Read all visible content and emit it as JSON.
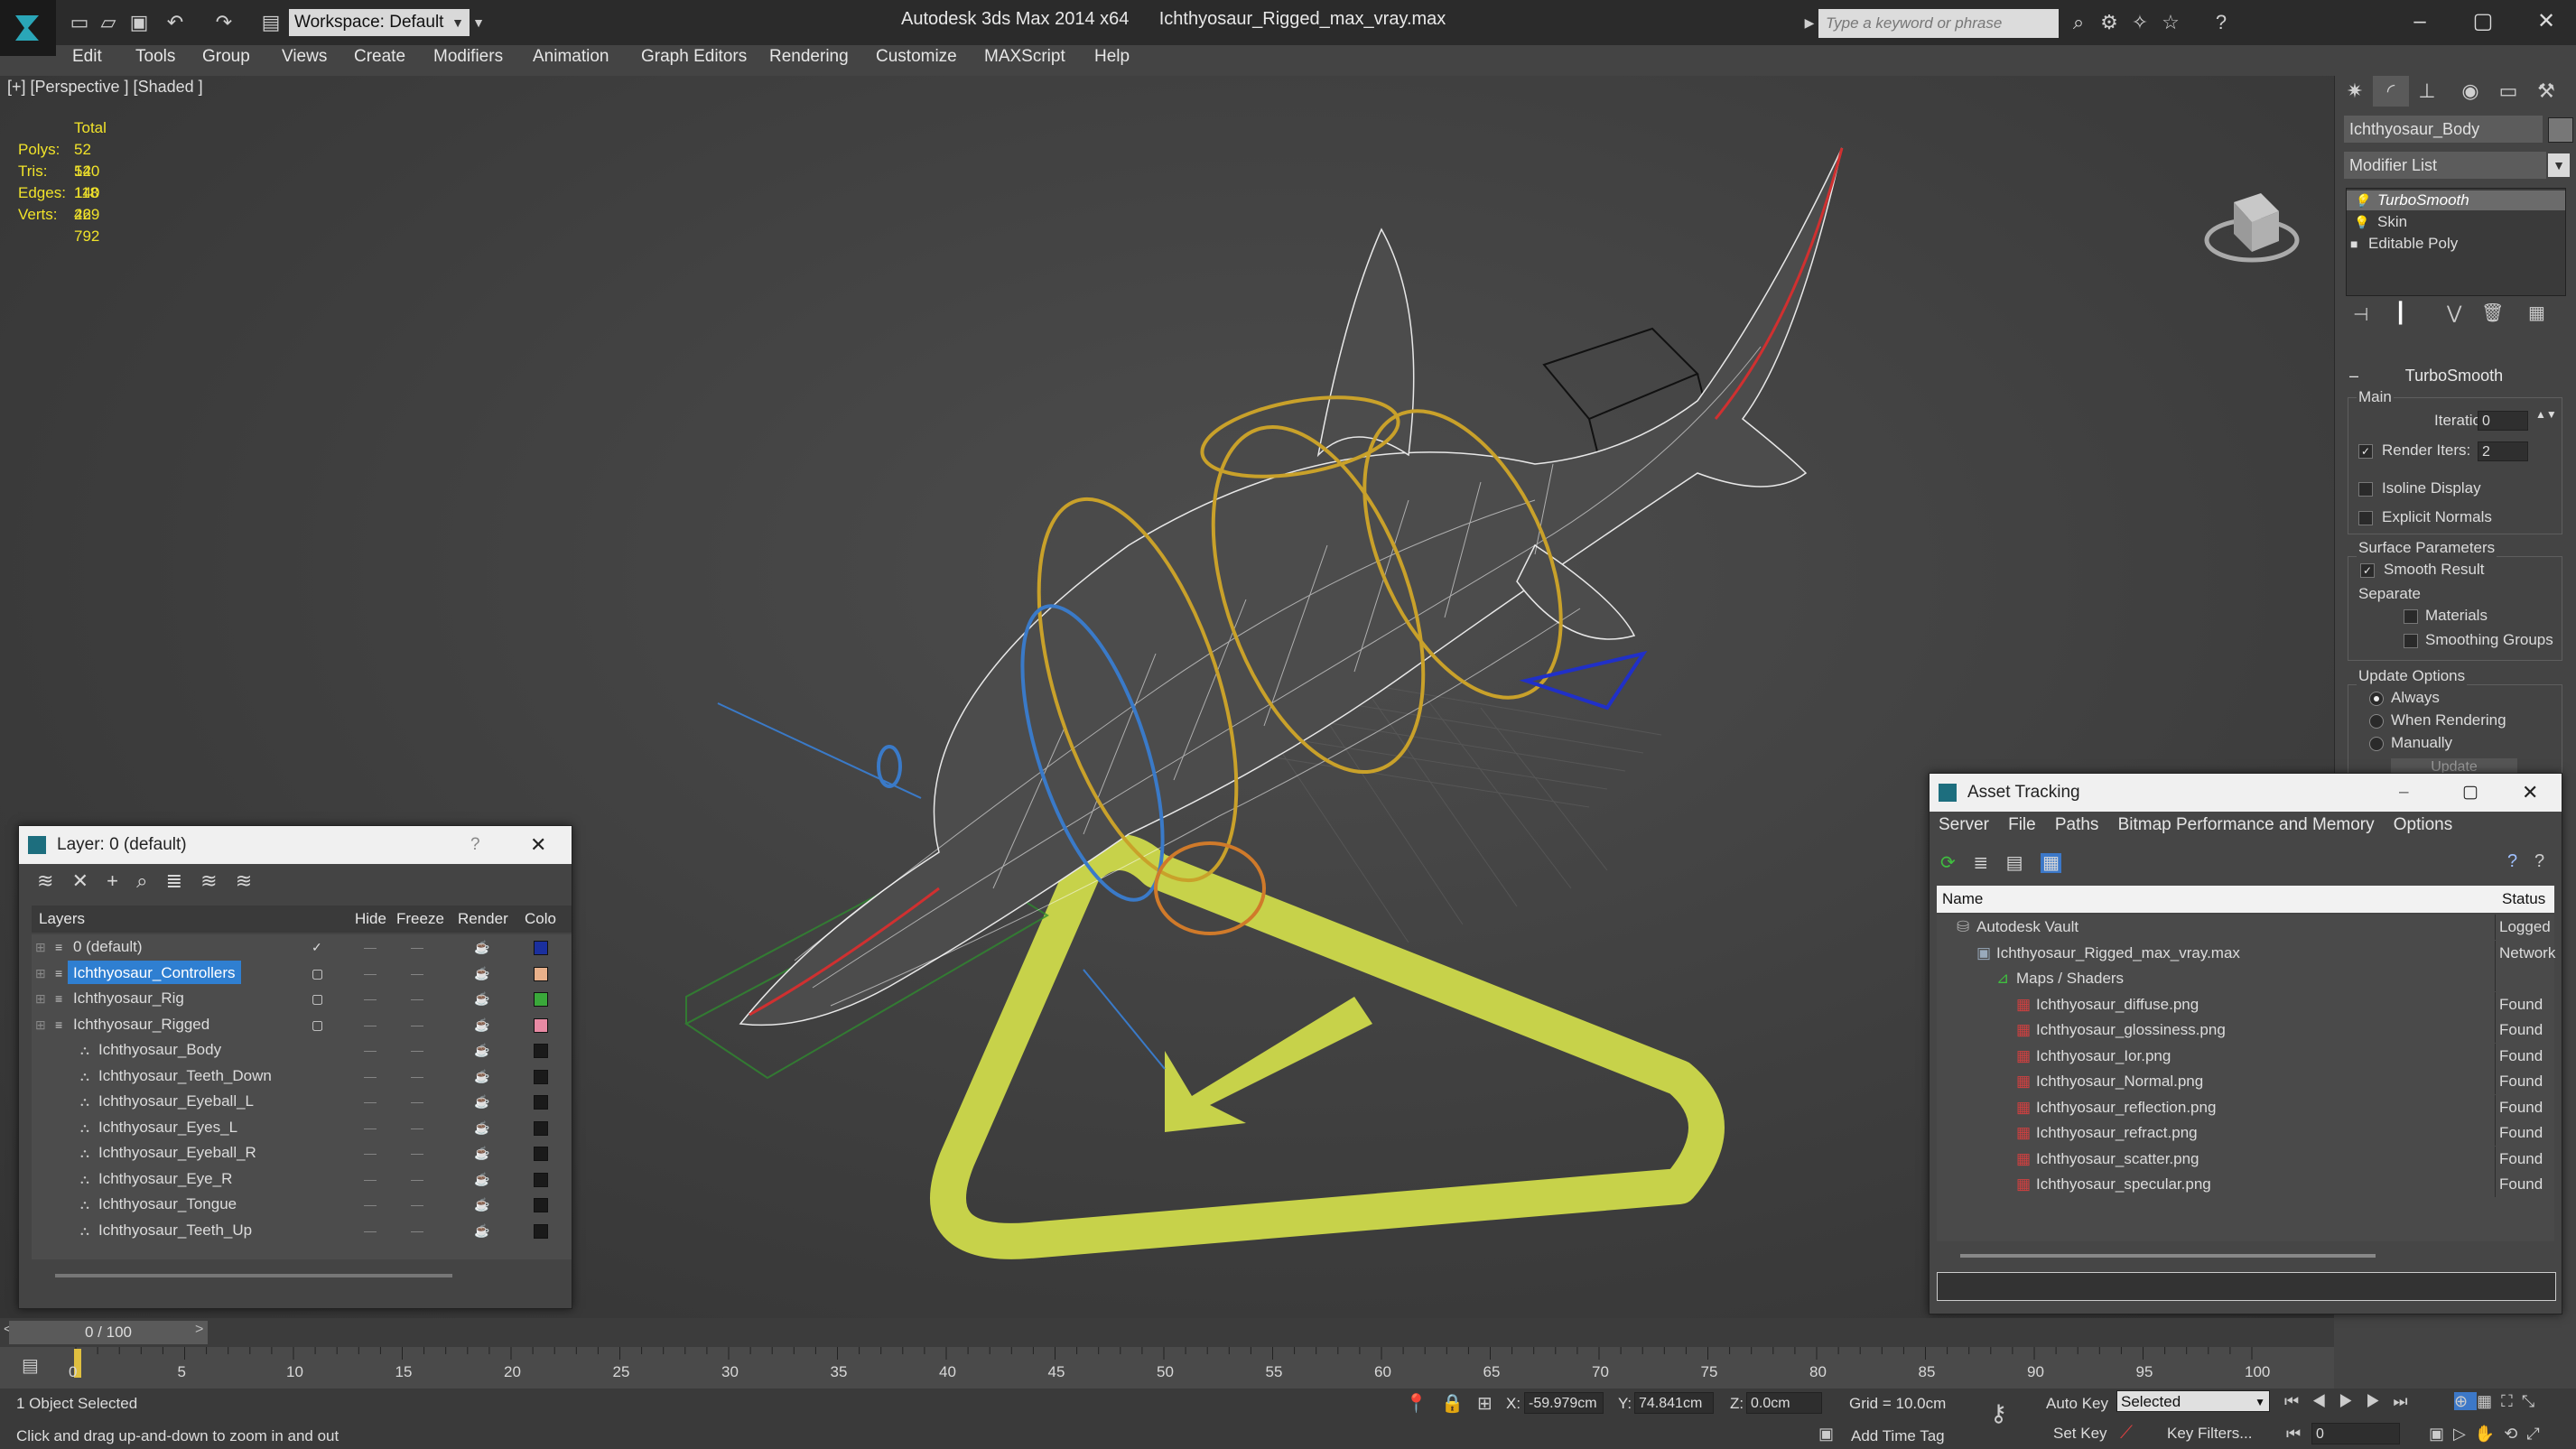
{
  "app": {
    "title": "Autodesk 3ds Max  2014 x64",
    "filename": "Ichthyosaur_Rigged_max_vray.max",
    "workspace": "Workspace: Default",
    "search_placeholder": "Type a keyword or phrase"
  },
  "menu": [
    "Edit",
    "Tools",
    "Group",
    "Views",
    "Create",
    "Modifiers",
    "Animation",
    "Graph Editors",
    "Rendering",
    "Customize",
    "MAXScript",
    "Help"
  ],
  "viewport": {
    "label": "[+] [Perspective ] [Shaded ]",
    "stats": {
      "header": "Total",
      "rows": [
        {
          "label": "Polys:",
          "value": "52 140"
        },
        {
          "label": "Tris:",
          "value": "52 140"
        },
        {
          "label": "Edges:",
          "value": "118 429"
        },
        {
          "label": "Verts:",
          "value": "26 792"
        }
      ]
    }
  },
  "command_panel": {
    "object_name": "Ichthyosaur_Body",
    "modifier_list": "Modifier List",
    "stack": [
      "TurboSmooth",
      "Skin",
      "Editable Poly"
    ],
    "rollout_title": "TurboSmooth",
    "main_group": "Main",
    "iterations_label": "Iterations:",
    "iterations_value": "0",
    "render_iters_label": "Render Iters:",
    "render_iters_value": "2",
    "isoline_display": "Isoline Display",
    "explicit_normals": "Explicit Normals",
    "surface_params": "Surface Parameters",
    "smooth_result": "Smooth Result",
    "separate": "Separate",
    "materials": "Materials",
    "smoothing_groups": "Smoothing Groups",
    "update_options": "Update Options",
    "always": "Always",
    "when_rendering": "When Rendering",
    "manually": "Manually",
    "update_btn": "Update"
  },
  "layer_window": {
    "title": "Layer: 0 (default)",
    "help": "?",
    "columns": [
      "Layers",
      "Hide",
      "Freeze",
      "Render",
      "Colo"
    ],
    "rows": [
      {
        "name": "0 (default)",
        "indent": 0,
        "color": "#1a2f9e",
        "check": true
      },
      {
        "name": "Ichthyosaur_Controllers",
        "indent": 0,
        "color": "#e8b08a",
        "selected": true
      },
      {
        "name": "Ichthyosaur_Rig",
        "indent": 0,
        "color": "#3aa83a"
      },
      {
        "name": "Ichthyosaur_Rigged",
        "indent": 0,
        "color": "#e88aa4"
      },
      {
        "name": "Ichthyosaur_Body",
        "indent": 1,
        "color": "#1a1a1a"
      },
      {
        "name": "Ichthyosaur_Teeth_Down",
        "indent": 1,
        "color": "#1a1a1a"
      },
      {
        "name": "Ichthyosaur_Eyeball_L",
        "indent": 1,
        "color": "#1a1a1a"
      },
      {
        "name": "Ichthyosaur_Eyes_L",
        "indent": 1,
        "color": "#1a1a1a"
      },
      {
        "name": "Ichthyosaur_Eyeball_R",
        "indent": 1,
        "color": "#1a1a1a"
      },
      {
        "name": "Ichthyosaur_Eye_R",
        "indent": 1,
        "color": "#1a1a1a"
      },
      {
        "name": "Ichthyosaur_Tongue",
        "indent": 1,
        "color": "#1a1a1a"
      },
      {
        "name": "Ichthyosaur_Teeth_Up",
        "indent": 1,
        "color": "#1a1a1a"
      }
    ]
  },
  "asset_window": {
    "title": "Asset Tracking",
    "menu": [
      "Server",
      "File",
      "Paths",
      "Bitmap Performance and Memory",
      "Options"
    ],
    "columns": [
      "Name",
      "Status"
    ],
    "rows": [
      {
        "name": "Autodesk Vault",
        "level": 0,
        "status": "Logged"
      },
      {
        "name": "Ichthyosaur_Rigged_max_vray.max",
        "level": 1,
        "status": "Network"
      },
      {
        "name": "Maps / Shaders",
        "level": 2,
        "status": ""
      },
      {
        "name": "Ichthyosaur_diffuse.png",
        "level": 3,
        "status": "Found"
      },
      {
        "name": "Ichthyosaur_glossiness.png",
        "level": 3,
        "status": "Found"
      },
      {
        "name": "Ichthyosaur_Ior.png",
        "level": 3,
        "status": "Found"
      },
      {
        "name": "Ichthyosaur_Normal.png",
        "level": 3,
        "status": "Found"
      },
      {
        "name": "Ichthyosaur_reflection.png",
        "level": 3,
        "status": "Found"
      },
      {
        "name": "Ichthyosaur_refract.png",
        "level": 3,
        "status": "Found"
      },
      {
        "name": "Ichthyosaur_scatter.png",
        "level": 3,
        "status": "Found"
      },
      {
        "name": "Ichthyosaur_specular.png",
        "level": 3,
        "status": "Found"
      }
    ]
  },
  "timeline": {
    "slider": "0 / 100",
    "ticks": [
      "0",
      "5",
      "10",
      "15",
      "20",
      "25",
      "30",
      "35",
      "40",
      "45",
      "50",
      "55",
      "60",
      "65",
      "70",
      "75",
      "80",
      "85",
      "90",
      "95",
      "100"
    ]
  },
  "status": {
    "selection": "1 Object Selected",
    "prompt": "Click and drag up-and-down to zoom in and out",
    "x_label": "X:",
    "x": "-59.979cm",
    "y_label": "Y:",
    "y": "74.841cm",
    "z_label": "Z:",
    "z": "0.0cm",
    "grid": "Grid = 10.0cm",
    "add_time_tag": "Add Time Tag",
    "auto_key": "Auto Key",
    "set_key": "Set Key",
    "selected": "Selected",
    "key_filters": "Key Filters...",
    "frame": "0"
  },
  "colors": {
    "accent_blue": "#2f7fd1",
    "stats_yellow": "#f0e22a",
    "controller_yellow": "#c7d24a"
  }
}
